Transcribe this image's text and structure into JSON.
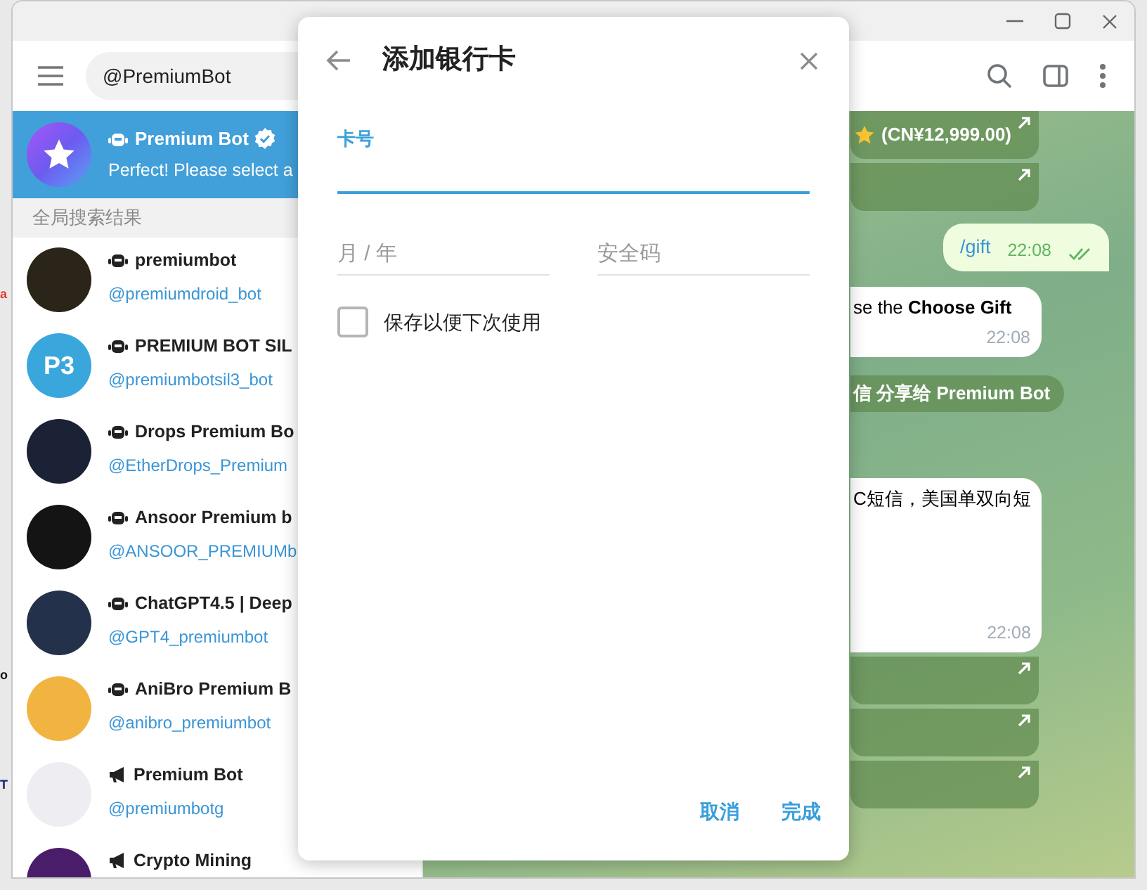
{
  "desktop_fragments": [
    {
      "text": "a",
      "color": "#e53935"
    },
    {
      "text": "o",
      "color": "#111111"
    },
    {
      "text": "T",
      "color": "#1a237e"
    }
  ],
  "sidebar": {
    "search": {
      "value": "@PremiumBot"
    },
    "top_result": {
      "name": "Premium Bot",
      "preview": "Perfect! Please select a",
      "verified": true,
      "selected": true,
      "kind": "bot"
    },
    "section_header": "全局搜索结果",
    "results": [
      {
        "name": "premiumbot",
        "username": "@premiumdroid_bot",
        "kind": "bot",
        "color": "#2b2418"
      },
      {
        "name": "PREMIUM BOT SIL",
        "username": "@premiumbotsil3_bot",
        "kind": "bot",
        "color": "#3aa7dc",
        "avatar_text": "P3"
      },
      {
        "name": "Drops Premium Bo",
        "username": "@EtherDrops_Premium",
        "kind": "bot",
        "color": "#1b2236"
      },
      {
        "name": "Ansoor Premium b",
        "username": "@ANSOOR_PREMIUMb",
        "kind": "bot",
        "color": "#141414"
      },
      {
        "name": "ChatGPT4.5 | Deep",
        "username": "@GPT4_premiumbot",
        "kind": "bot",
        "color": "#23324a"
      },
      {
        "name": "AniBro Premium B",
        "username": "@anibro_premiumbot",
        "kind": "bot",
        "color": "#f2b441"
      },
      {
        "name": "Premium Bot",
        "username": "@premiumbotg",
        "kind": "channel",
        "color": "#eeeef2"
      },
      {
        "name": "Crypto Mining",
        "kind": "channel",
        "color": "#4a1d6b"
      }
    ]
  },
  "chat": {
    "messages": [
      {
        "kind": "inline_button",
        "text": "(CN¥12,999.00)",
        "star": true
      },
      {
        "kind": "inline_button"
      },
      {
        "kind": "outgoing",
        "text": "/gift",
        "time": "22:08",
        "read": true
      },
      {
        "kind": "incoming",
        "text": "se the **Choose Gift**",
        "time": "22:08"
      },
      {
        "kind": "service",
        "text": "信 分享给 Premium Bot"
      },
      {
        "kind": "incoming",
        "text": "C短信，美国单双向短",
        "time": "22:08",
        "tall": true
      },
      {
        "kind": "inline_button"
      },
      {
        "kind": "inline_button"
      },
      {
        "kind": "inline_button"
      }
    ]
  },
  "dialog": {
    "title": "添加银行卡",
    "fields": [
      {
        "label": "卡号",
        "focused": true
      },
      {
        "placeholder": "月 / 年",
        "focused": false
      },
      {
        "placeholder": "安全码",
        "focused": false
      }
    ],
    "checkbox": {
      "label": "保存以便下次使用",
      "checked": false
    },
    "buttons": [
      "取消",
      "完成"
    ]
  }
}
